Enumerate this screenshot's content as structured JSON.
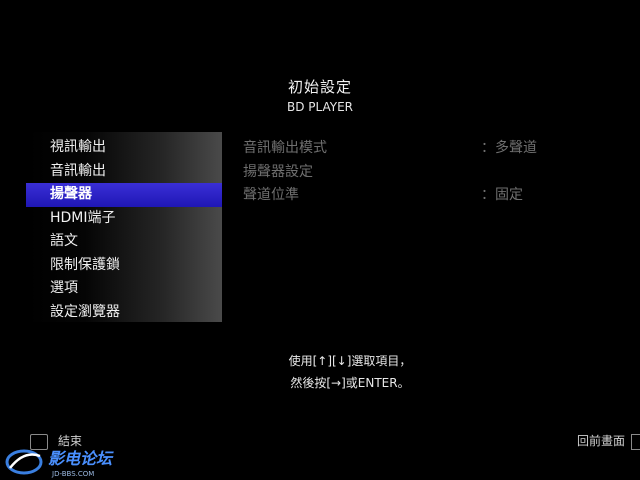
{
  "header": {
    "title": "初始設定",
    "subtitle": "BD PLAYER"
  },
  "menu": {
    "items": [
      {
        "label": "視訊輸出"
      },
      {
        "label": "音訊輸出"
      },
      {
        "label": "揚聲器"
      },
      {
        "label": "HDMI端子"
      },
      {
        "label": "語文"
      },
      {
        "label": "限制保護鎖"
      },
      {
        "label": "選項"
      },
      {
        "label": "設定瀏覽器"
      }
    ],
    "selected_label": "揚聲器"
  },
  "settings": [
    {
      "label": "音訊輸出模式",
      "value": "：多聲道"
    },
    {
      "label": "揚聲器設定",
      "value": ""
    },
    {
      "label": "聲道位準",
      "value": "：固定"
    }
  ],
  "hint": {
    "line1": "使用[↑][↓]選取項目，",
    "line2": "然後按[→]或ENTER。"
  },
  "footer": {
    "exit_label": "結束",
    "back_label": "回前畫面"
  },
  "watermark": {
    "text": "影电论坛",
    "url_text": "JD-BBS.COM"
  },
  "colors": {
    "selection": "#2a20c8",
    "background": "#000000",
    "dim_text": "#6f6f6f"
  }
}
